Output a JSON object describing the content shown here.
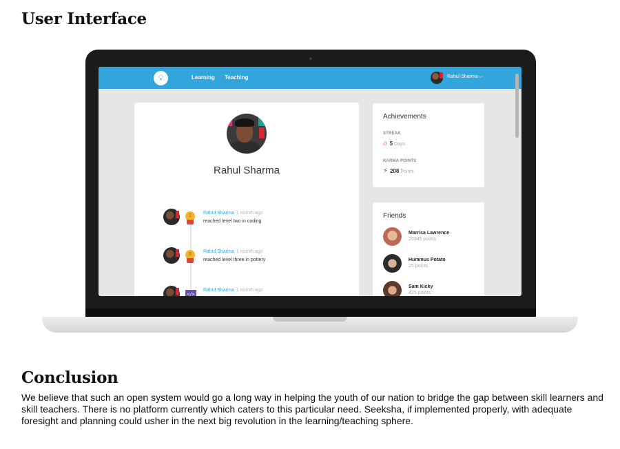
{
  "document": {
    "heading": "User Interface",
    "conclusion_heading": "Conclusion",
    "conclusion_text": "We believe that such an open system would go a long way in helping the youth of our nation to bridge the gap between skill learners and skill teachers. There is no platform currently which caters to this particular need. Seeksha, if implemented properly, with adequate foresight and planning could usher in the next big revolution in the learning/teaching sphere."
  },
  "app": {
    "nav": {
      "logo_icon": "lightbulb-icon",
      "links": [
        "Learning",
        "Teaching"
      ],
      "user_name": "Rahul Sharma",
      "chevron_icon": "chevron-down-icon"
    },
    "profile": {
      "name": "Rahul Sharma",
      "feed": [
        {
          "author": "Rahul Sharma",
          "time": "1 month ago",
          "text": "reached level two in coding",
          "badge": "2",
          "badge_type": "medal"
        },
        {
          "author": "Rahul Sharma",
          "time": "1 month ago",
          "text": "reached level three in pottery",
          "badge": "3",
          "badge_type": "medal"
        },
        {
          "author": "Rahul Sharma",
          "time": "1 month ago",
          "text": "",
          "badge": "</>",
          "badge_type": "code"
        }
      ]
    },
    "achievements": {
      "title": "Achievements",
      "streak_label": "STREAK",
      "streak_value": "5",
      "streak_unit": "Days",
      "karma_label": "KARMA POINTS",
      "karma_value": "208",
      "karma_unit": "Points"
    },
    "friends": {
      "title": "Friends",
      "list": [
        {
          "name": "Marrisa Lawrence",
          "points": "20345 points"
        },
        {
          "name": "Hummus Potato",
          "points": "25 points"
        },
        {
          "name": "Sam Kicky",
          "points": "425 points"
        }
      ]
    },
    "colors": {
      "accent": "#33a5dd",
      "screen_bg": "#e6e6e6",
      "laptop_frame": "#1b1b1b"
    }
  }
}
